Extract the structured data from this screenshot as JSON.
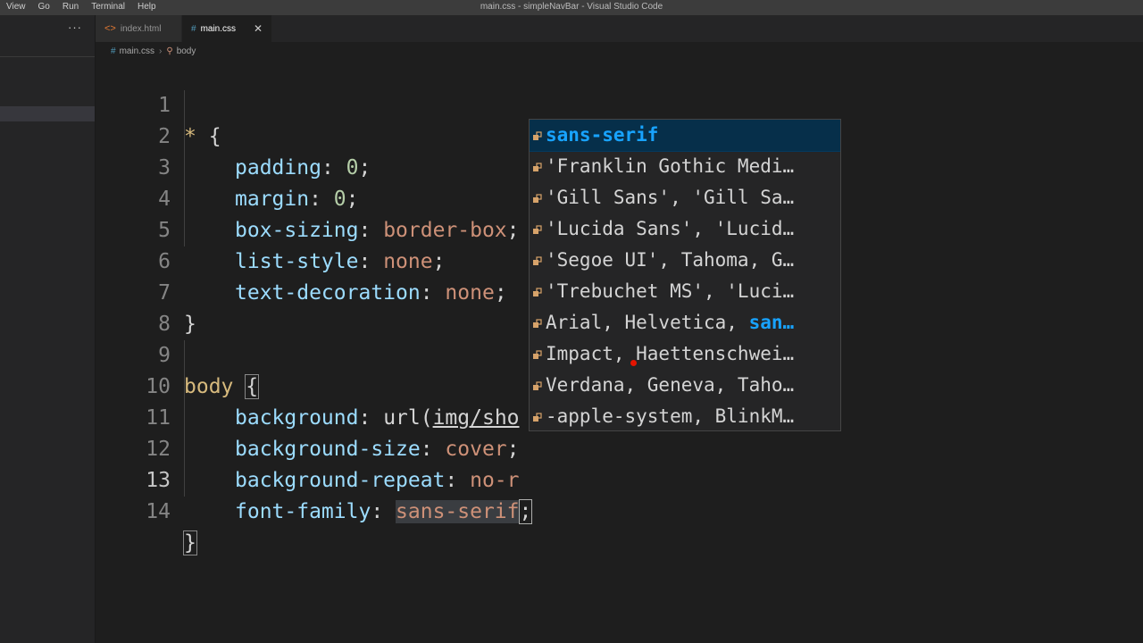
{
  "menu": [
    "View",
    "Go",
    "Run",
    "Terminal",
    "Help"
  ],
  "window_title": "main.css - simpleNavBar - Visual Studio Code",
  "sidebar": {
    "more": "···"
  },
  "tabs": [
    {
      "label": "index.html",
      "icon": "html-file-icon",
      "active": false
    },
    {
      "label": "main.css",
      "icon": "css-file-icon",
      "active": true,
      "close": "✕"
    }
  ],
  "breadcrumb": {
    "file": "main.css",
    "symbol": "body"
  },
  "editor": {
    "active_line": 13,
    "line_numbers": [
      "1",
      "2",
      "3",
      "4",
      "5",
      "6",
      "7",
      "8",
      "9",
      "10",
      "11",
      "12",
      "13",
      "14"
    ],
    "lines": {
      "l1": {
        "sel": "*",
        "brace": "{"
      },
      "l2": {
        "prop": "padding",
        "val": "0"
      },
      "l3": {
        "prop": "margin",
        "val": "0"
      },
      "l4": {
        "prop": "box-sizing",
        "val": "border-box"
      },
      "l5": {
        "prop": "list-style",
        "val": "none"
      },
      "l6": {
        "prop": "text-decoration",
        "val": "none"
      },
      "l7": {
        "brace": "}"
      },
      "l9": {
        "sel": "body",
        "brace": "{"
      },
      "l10": {
        "prop": "background",
        "fn": "url(",
        "val": "img/sho"
      },
      "l11": {
        "prop": "background-size",
        "val": "cover"
      },
      "l12": {
        "prop": "background-repeat",
        "val": "no-r"
      },
      "l13": {
        "prop": "font-family",
        "val": "sans-serif"
      },
      "l14": {
        "brace": "}"
      }
    }
  },
  "suggestions": [
    {
      "pre": "",
      "match": "sans-serif",
      "post": "",
      "selected": true
    },
    {
      "pre": "'Franklin Gothic Medi…",
      "match": "",
      "post": ""
    },
    {
      "pre": "'Gill Sans', 'Gill Sa…",
      "match": "",
      "post": ""
    },
    {
      "pre": "'Lucida Sans', 'Lucid…",
      "match": "",
      "post": ""
    },
    {
      "pre": "'Segoe UI', Tahoma, G…",
      "match": "",
      "post": ""
    },
    {
      "pre": "'Trebuchet MS', 'Luci…",
      "match": "",
      "post": ""
    },
    {
      "pre": "Arial, Helvetica, ",
      "match": "san…",
      "post": ""
    },
    {
      "pre": "Impact, Haettenschwei…",
      "match": "",
      "post": ""
    },
    {
      "pre": "Verdana, Geneva, Taho…",
      "match": "",
      "post": ""
    },
    {
      "pre": "-apple-system, BlinkM…",
      "match": "",
      "post": ""
    }
  ],
  "suggestion_icon": "property-value-icon",
  "colors": {
    "property": "#9cdcfe",
    "value": "#ce9178",
    "number": "#b5cea8",
    "selector": "#d7ba7d",
    "match": "#18a3ff"
  }
}
